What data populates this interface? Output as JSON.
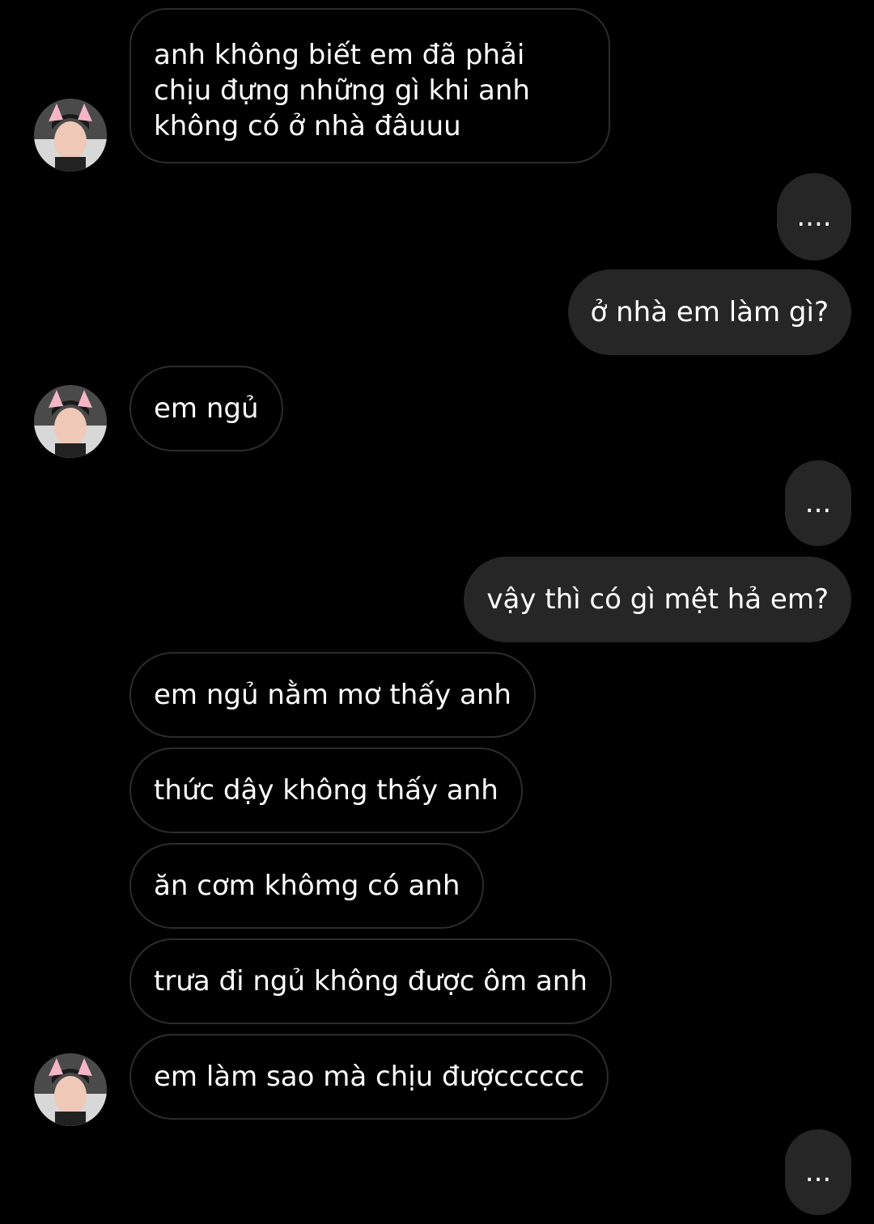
{
  "messages": [
    {
      "side": "in",
      "text": "anh không biết em đã phải chịu đựng những gì khi anh không có ở nhà đâuuu"
    },
    {
      "side": "out",
      "text": "...."
    },
    {
      "side": "out",
      "text": "ở nhà em làm gì?"
    },
    {
      "side": "in",
      "text": "em ngủ"
    },
    {
      "side": "out",
      "text": "..."
    },
    {
      "side": "out",
      "text": "vậy thì có gì mệt hả em?"
    },
    {
      "side": "in",
      "text": "em ngủ nằm mơ thấy anh"
    },
    {
      "side": "in",
      "text": "thức dậy không thấy anh"
    },
    {
      "side": "in",
      "text": "ăn cơm khômg có anh"
    },
    {
      "side": "in",
      "text": "trưa đi ngủ không được ôm anh"
    },
    {
      "side": "in",
      "text": "em làm sao mà chịu đượcccccc"
    },
    {
      "side": "out",
      "text": "..."
    }
  ],
  "colors": {
    "background": "#000000",
    "incoming_border": "#2c2c2c",
    "outgoing_bubble": "#262626",
    "text": "#ffffff"
  },
  "avatar_icon": "profile-photo-with-cat-ear-filter"
}
